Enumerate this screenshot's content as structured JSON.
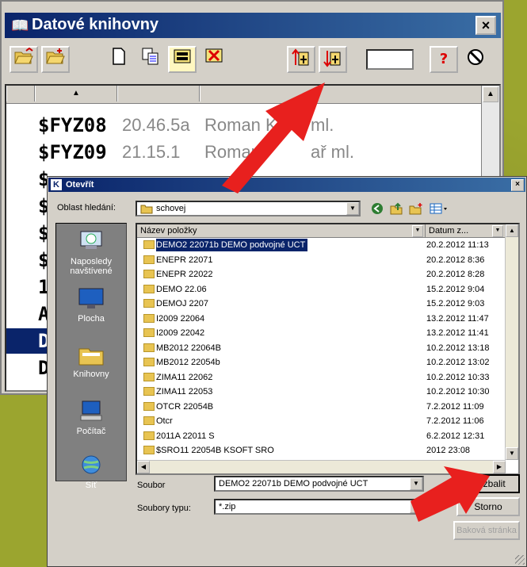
{
  "main_window": {
    "title": "Datové knihovny",
    "icon": "library-book-icon",
    "close_label": "×",
    "toolbar": {
      "buttons": [
        "open-folder-icon",
        "open-folder-alt-icon",
        "new-document-icon",
        "copy-icon",
        "save-icon",
        "delete-icon",
        "restore-up-icon",
        "restore-down-icon",
        "help-icon",
        "disconnect-icon"
      ],
      "help_label": "?"
    },
    "list": {
      "sort_indicator": "▲",
      "rows": [
        {
          "name": "$FYZ08",
          "version": "20.46.5a",
          "author": "Roman K",
          "extra": "ml."
        },
        {
          "name": "$FYZ09",
          "version": "21.15.1",
          "author": "Roman",
          "extra": "ař ml."
        },
        {
          "name": "$",
          "version": "",
          "author": "",
          "extra": ""
        },
        {
          "name": "$",
          "version": "",
          "author": "",
          "extra": ""
        },
        {
          "name": "$",
          "version": "",
          "author": "",
          "extra": ""
        },
        {
          "name": "$",
          "version": "",
          "author": "",
          "extra": ""
        },
        {
          "name": "1",
          "version": "",
          "author": "",
          "extra": ""
        },
        {
          "name": "A",
          "version": "",
          "author": "",
          "extra": ""
        },
        {
          "name": "D",
          "version": "",
          "author": "",
          "extra": "",
          "selected": true
        },
        {
          "name": "D",
          "version": "",
          "author": "",
          "extra": ""
        }
      ]
    }
  },
  "dialog": {
    "title": "Otevřít",
    "title_icon": "K",
    "close_label": "×",
    "look_in_label": "Oblast hledání:",
    "look_in_value": "schovej",
    "places": [
      {
        "label": "Naposledy navštívené",
        "icon": "recent-places-icon"
      },
      {
        "label": "Plocha",
        "icon": "desktop-icon"
      },
      {
        "label": "Knihovny",
        "icon": "libraries-icon"
      },
      {
        "label": "Počítač",
        "icon": "computer-icon"
      },
      {
        "label": "Síť",
        "icon": "network-icon"
      }
    ],
    "columns": {
      "name": "Název položky",
      "date": "Datum z..."
    },
    "files": [
      {
        "name": "DEMO2  22071b DEMO podvojné UCT",
        "date": "20.2.2012 11:13",
        "selected": true
      },
      {
        "name": "ENEPR  22071",
        "date": "20.2.2012 8:36"
      },
      {
        "name": "ENEPR  22022",
        "date": "20.2.2012 8:28"
      },
      {
        "name": "DEMO   22.06",
        "date": "15.2.2012 9:04"
      },
      {
        "name": "DEMOJ  2207",
        "date": "15.2.2012 9:03"
      },
      {
        "name": "I2009  22064",
        "date": "13.2.2012 11:47"
      },
      {
        "name": "I2009  22042",
        "date": "13.2.2012 11:41"
      },
      {
        "name": "MB2012  22064B",
        "date": "10.2.2012 13:18"
      },
      {
        "name": "MB2012  22054b",
        "date": "10.2.2012 13:02"
      },
      {
        "name": "ZIMA11  22062",
        "date": "10.2.2012 10:33"
      },
      {
        "name": "ZIMA11  22053",
        "date": "10.2.2012 10:30"
      },
      {
        "name": "OTCR   22054B",
        "date": "7.2.2012 11:09"
      },
      {
        "name": "Otcr",
        "date": "7.2.2012 11:06"
      },
      {
        "name": "2011A  22011 S",
        "date": "6.2.2012 12:31"
      },
      {
        "name": "$SRO11  22054B KSOFT SRO",
        "date": "2012 23:08"
      }
    ],
    "file_label": "Soubor",
    "file_value": "DEMO2  22071b DEMO podvojné UCT",
    "type_label": "Soubory typu:",
    "type_value": "*.zip",
    "buttons": {
      "open": "Rozbalit",
      "cancel": "Storno",
      "web": "Baková stránka"
    }
  },
  "colors": {
    "accent_arrow": "#e8201e",
    "titlebar": "#0a246a",
    "selection": "#0a246a",
    "background": "#9ba52f"
  }
}
